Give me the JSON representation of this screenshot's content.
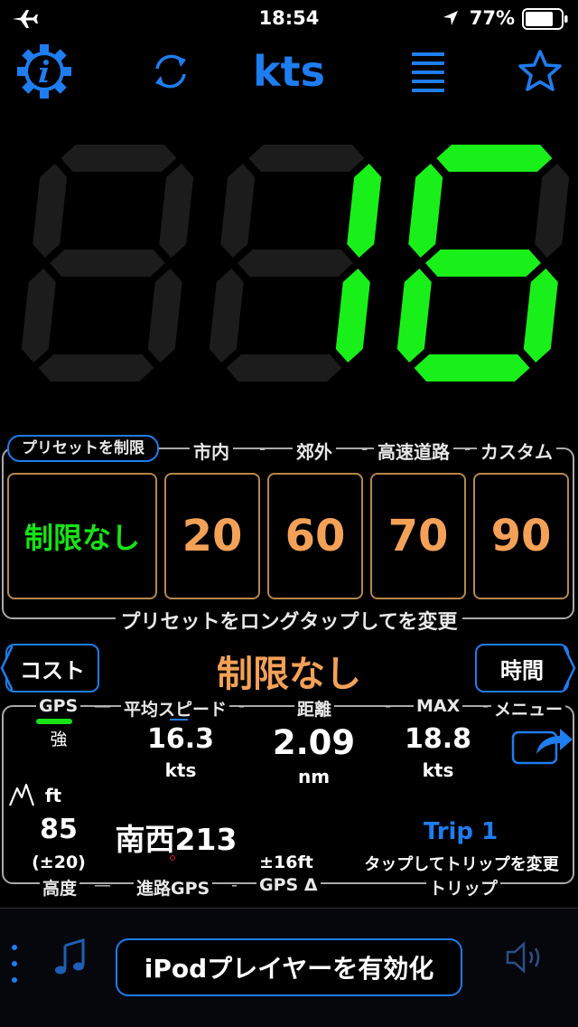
{
  "status_bar": {
    "time": "18:54",
    "battery_percent": "77%",
    "icons": [
      "airplane-icon",
      "location-arrow-icon",
      "battery-icon"
    ]
  },
  "top_bar": {
    "unit": "kts",
    "icons": [
      "info-gear-icon",
      "refresh-icon",
      "menu-list-icon",
      "star-icon"
    ]
  },
  "speed_display": {
    "value": "16",
    "color_active": "#19f019",
    "color_inactive": "#1c1c1c"
  },
  "presets": {
    "section_label": "プリセットを制限",
    "categories": [
      "市内",
      "郊外",
      "高速道路",
      "カスタム"
    ],
    "no_limit": "制限なし",
    "values": [
      "20",
      "60",
      "70",
      "90"
    ],
    "footer": "プリセットをロングタップしてを変更"
  },
  "mode": {
    "cost_label": "コスト",
    "limit_title": "制限なし",
    "time_label": "時間"
  },
  "stats": {
    "gps": {
      "label": "GPS",
      "strength": "強"
    },
    "avg_speed": {
      "label": "平均スピード",
      "value": "16.3",
      "unit": "kts"
    },
    "distance": {
      "label": "距離",
      "value": "2.09",
      "unit": "nm"
    },
    "max": {
      "label": "MAX",
      "value": "18.8",
      "unit": "kts"
    },
    "menu": {
      "label": "メニュー"
    },
    "altitude": {
      "unit": "ft",
      "value": "85",
      "accuracy": "(±20)",
      "label": "高度"
    },
    "heading": {
      "value": "南西213",
      "label": "進路GPS"
    },
    "gps_delta": {
      "value": "±16ft",
      "label": "GPS Δ"
    },
    "trip": {
      "name": "Trip 1",
      "hint": "タップしてトリップを変更",
      "label": "トリップ"
    }
  },
  "bottom_bar": {
    "ipod_label": "iPodプレイヤーを有効化",
    "icons": [
      "more-dots-icon",
      "music-note-icon",
      "speaker-icon"
    ]
  },
  "colors": {
    "accent": "#1e7df0",
    "speed_green": "#19f019",
    "preset_orange": "#f4a158",
    "preset_border": "#b8864a",
    "gps_strength_bar": "#17e317"
  }
}
